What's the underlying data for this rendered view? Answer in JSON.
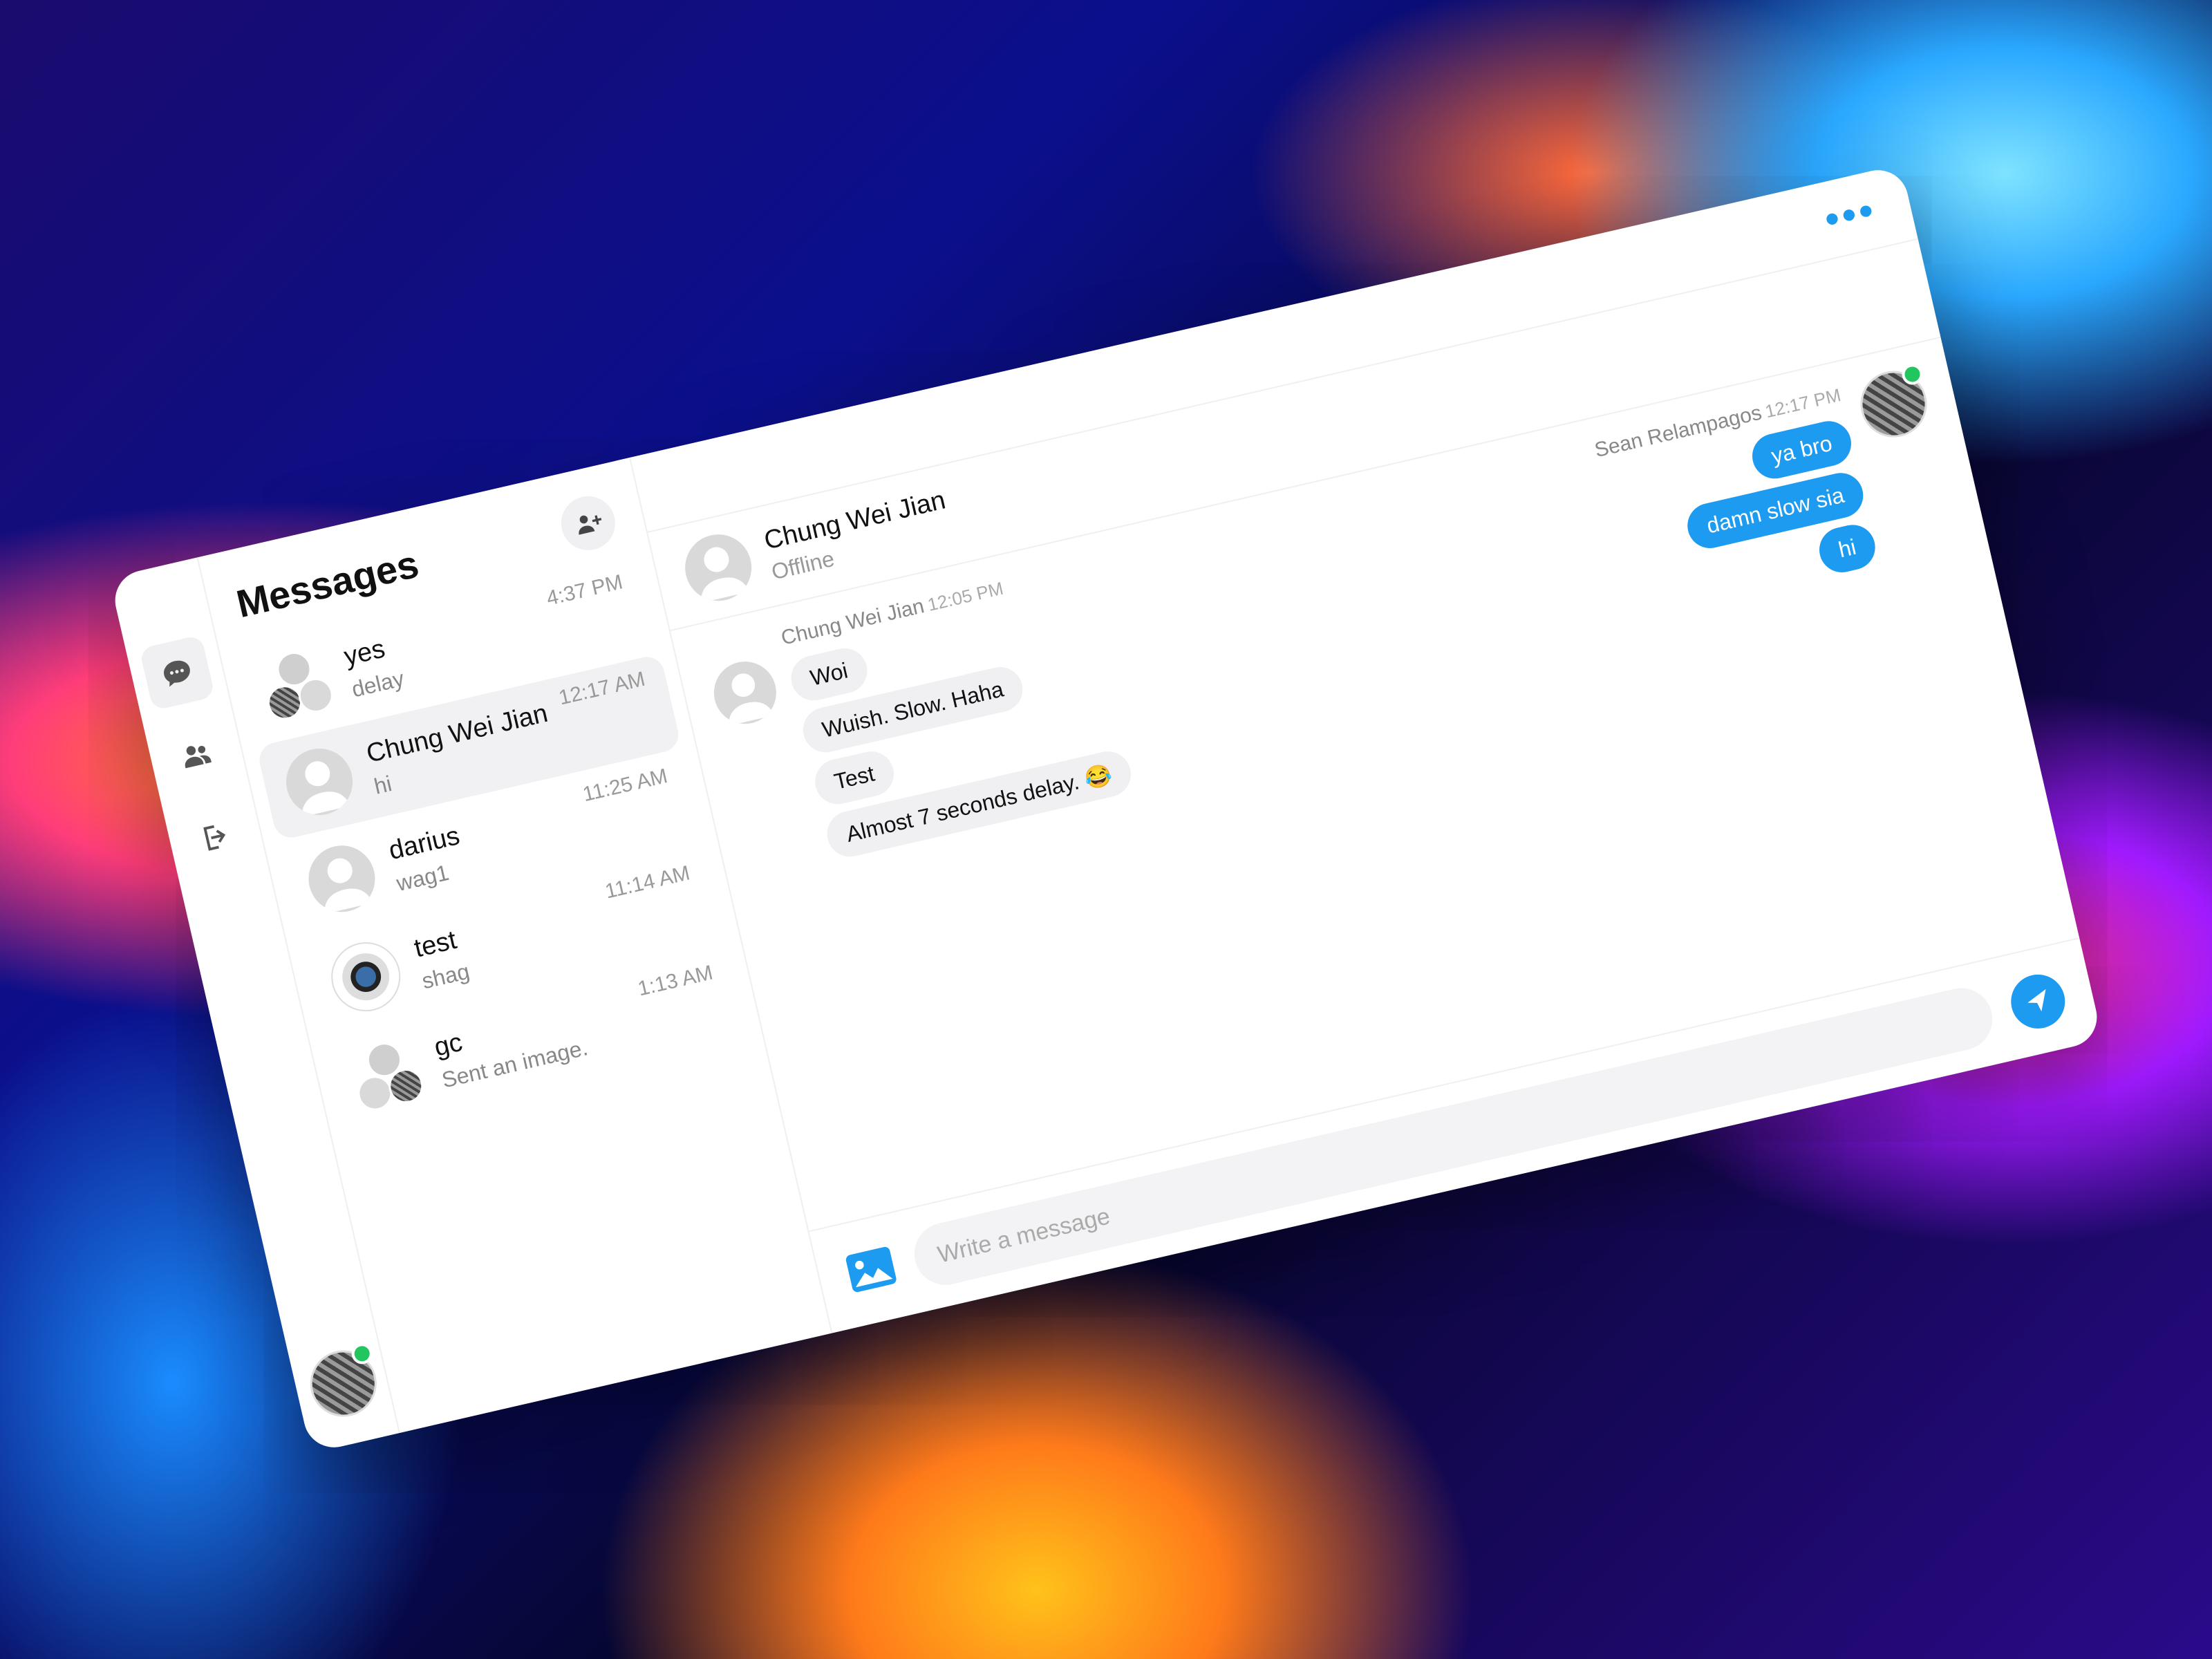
{
  "list": {
    "title": "Messages",
    "conversations": [
      {
        "name": "yes",
        "preview": "delay",
        "time": "4:37 PM"
      },
      {
        "name": "Chung Wei Jian",
        "preview": "hi",
        "time": "12:17 AM"
      },
      {
        "name": "darius",
        "preview": "wag1",
        "time": "11:25 AM"
      },
      {
        "name": "test",
        "preview": "shag",
        "time": "11:14 AM"
      },
      {
        "name": "gc",
        "preview": "Sent an image.",
        "time": "1:13 AM"
      }
    ]
  },
  "chat": {
    "menu_icon": "•••",
    "contact_name": "Chung Wei Jian",
    "contact_status": "Offline",
    "incoming": {
      "sender": "Chung Wei Jian",
      "time": "12:05 PM",
      "messages": [
        "Woi",
        "Wuish. Slow. Haha",
        "Test",
        "Almost 7 seconds delay. 😂"
      ]
    },
    "outgoing": {
      "sender": "Sean Relampagos",
      "time": "12:17 PM",
      "messages": [
        "ya bro",
        "damn slow sia",
        "hi"
      ]
    },
    "composer": {
      "placeholder": "Write a message"
    }
  },
  "colors": {
    "accent": "#1d9bf0",
    "online": "#22c55e"
  }
}
